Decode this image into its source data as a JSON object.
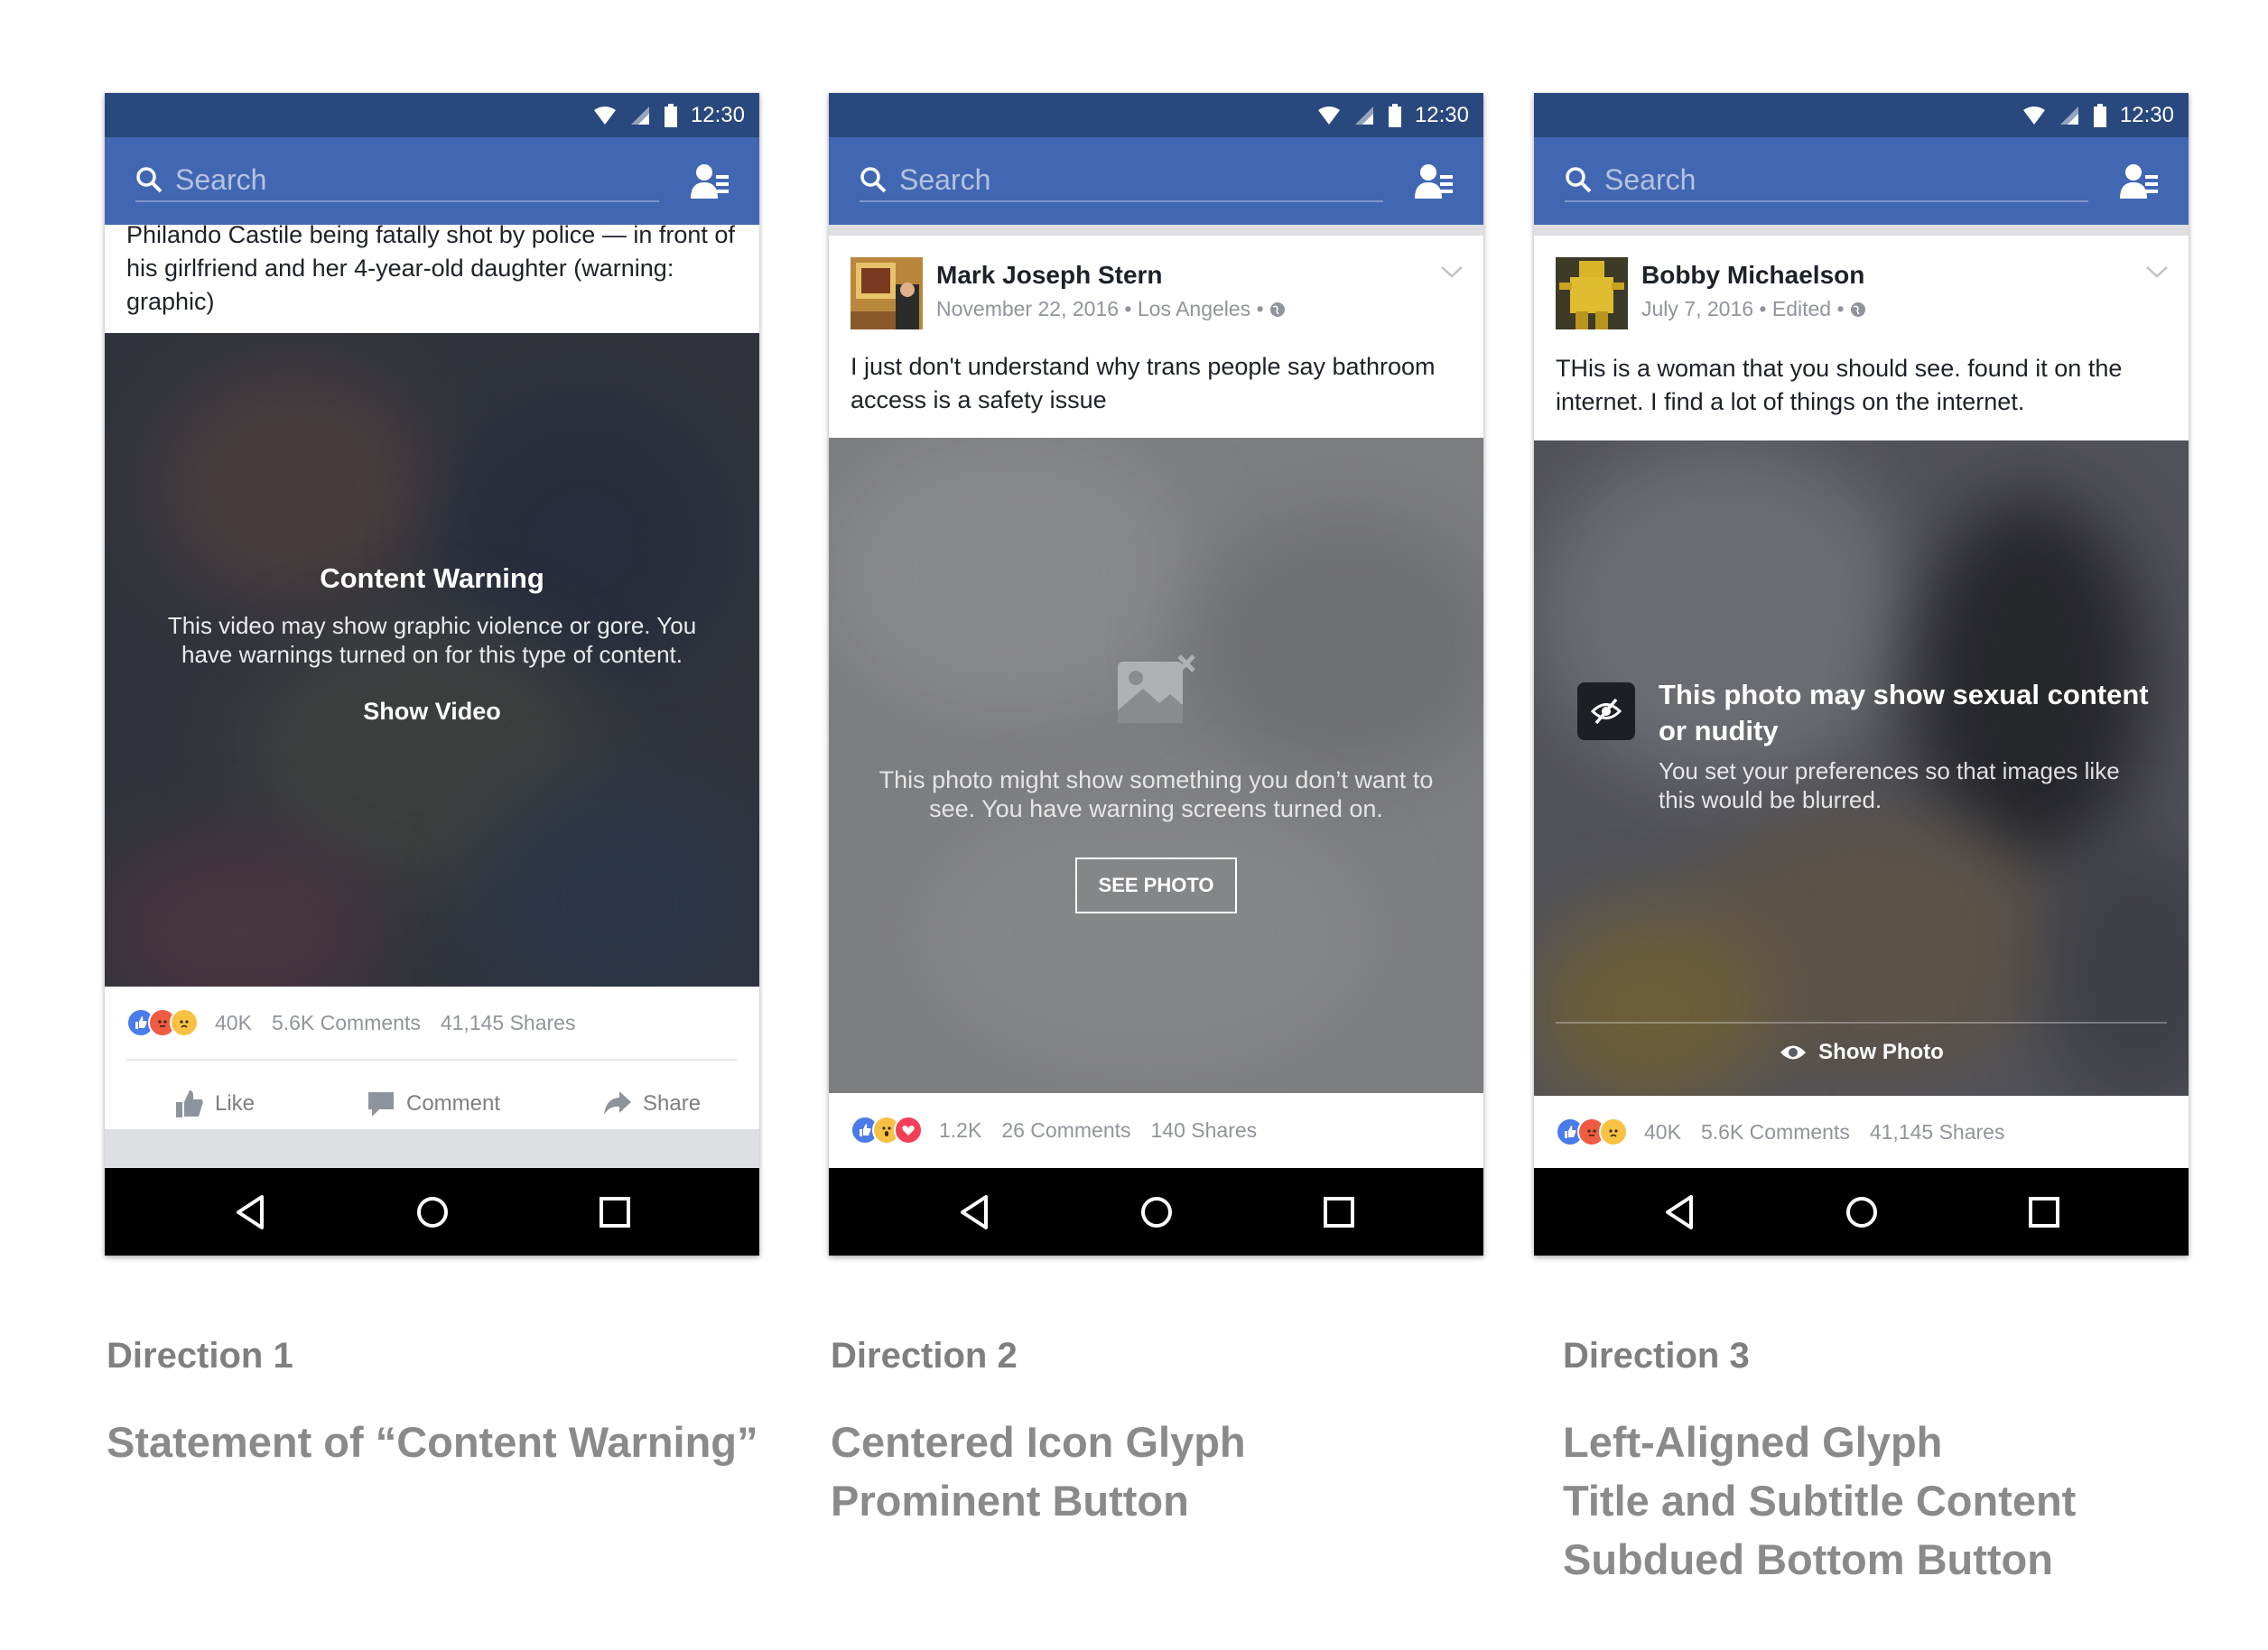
{
  "status": {
    "time": "12:30"
  },
  "search": {
    "placeholder": "Search"
  },
  "direction1": {
    "caption": "Philando Castile being fatally shot by police — in front of his girlfriend and her 4-year-old daughter (warning: graphic)",
    "warning_title": "Content Warning",
    "warning_body": "This video may show graphic violence or gore. You have warnings turned on for this type of content.",
    "show_label": "Show Video",
    "reactions": {
      "count": "40K",
      "comments": "5.6K Comments",
      "shares": "41,145 Shares",
      "types": [
        "like",
        "angry",
        "sad"
      ]
    },
    "actions": {
      "like": "Like",
      "comment": "Comment",
      "share": "Share"
    },
    "label_title": "Direction 1",
    "label_lines": [
      "Statement of “Content Warning”"
    ]
  },
  "direction2": {
    "author": "Mark Joseph Stern",
    "date": "November 22, 2016",
    "location": "Los Angeles",
    "post_text": "I just don't understand why trans people say bathroom access is a safety issue",
    "warning_body": "This photo might show something you don’t want to see. You have warning screens turned on.",
    "button_label": "SEE PHOTO",
    "reactions": {
      "count": "1.2K",
      "comments": "26 Comments",
      "shares": "140 Shares",
      "types": [
        "like",
        "wow",
        "love"
      ]
    },
    "label_title": "Direction 2",
    "label_lines": [
      "Centered Icon Glyph",
      "Prominent Button"
    ]
  },
  "direction3": {
    "author": "Bobby Michaelson",
    "date": "July 7, 2016",
    "edited": "Edited",
    "post_text": "THis is a woman that you should see. found it on the internet. I find a lot of things on the internet.",
    "warning_title": "This photo may show sexual content or nudity",
    "warning_body": "You set your preferences so that images like this would be blurred.",
    "show_label": "Show Photo",
    "reactions": {
      "count": "40K",
      "comments": "5.6K Comments",
      "shares": "41,145 Shares",
      "types": [
        "like",
        "angry",
        "sad"
      ]
    },
    "label_title": "Direction 3",
    "label_lines": [
      "Left-Aligned Glyph",
      "Title and Subtitle Content",
      "Subdued Bottom Button"
    ]
  },
  "colors": {
    "status_bar": "#29487d",
    "search_bar": "#4267b2",
    "like_blue": "#4a7bea",
    "angry_orange": "#f05b43",
    "love_red": "#f33e58",
    "muted_text": "#90949c"
  },
  "icons": [
    "wifi-icon",
    "signal-icon",
    "battery-icon",
    "search-icon",
    "friend-requests-icon",
    "back-icon",
    "home-icon",
    "recents-icon",
    "image-blocked-icon",
    "eye-slash-icon",
    "eye-icon",
    "thumbs-up-icon",
    "comment-icon",
    "share-icon",
    "globe-icon",
    "chevron-down-icon"
  ]
}
